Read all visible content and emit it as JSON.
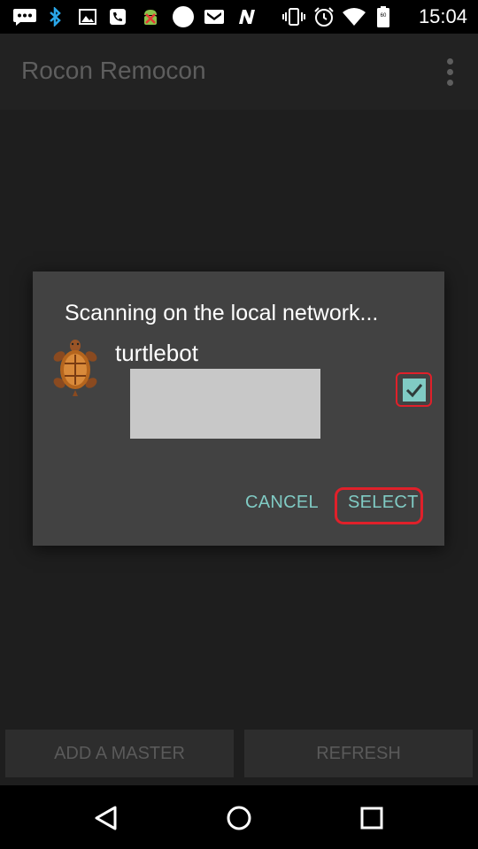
{
  "status_bar": {
    "time": "15:04",
    "icons": [
      "chat-icon",
      "bluetooth-icon",
      "image-icon",
      "contacts-icon",
      "android-bug-icon",
      "circle-icon",
      "mail-icon",
      "n-icon",
      "vibrate-icon",
      "alarm-icon",
      "wifi-icon",
      "battery-icon"
    ]
  },
  "app_bar": {
    "title": "Rocon Remocon"
  },
  "dialog": {
    "title": "Scanning on the local network...",
    "item": {
      "name": "turtlebot",
      "checked": true
    },
    "cancel_label": "CANCEL",
    "select_label": "SELECT"
  },
  "bottom": {
    "add_master_label": "ADD A MASTER",
    "refresh_label": "REFRESH"
  },
  "colors": {
    "accent": "#80cbc4",
    "highlight": "#e0202a",
    "dialog_bg": "#424242"
  }
}
